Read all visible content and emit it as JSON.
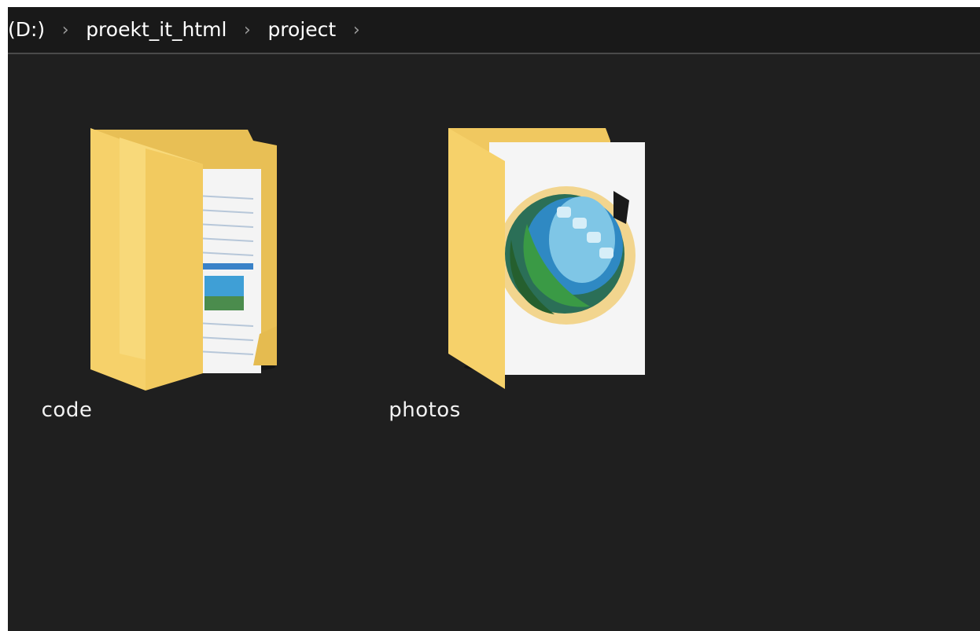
{
  "address_bar": {
    "drive": "(D:)",
    "folder1": "proekt_it_html",
    "folder2": "project",
    "separator": "›"
  },
  "items": [
    {
      "name": "code",
      "icon": "folder-documents-icon"
    },
    {
      "name": "photos",
      "icon": "folder-image-icon"
    }
  ],
  "colors": {
    "background": "#1f1f1f",
    "folder": "#f6d16a",
    "folder_dark": "#e2b64b",
    "text": "#f2f2f2"
  }
}
